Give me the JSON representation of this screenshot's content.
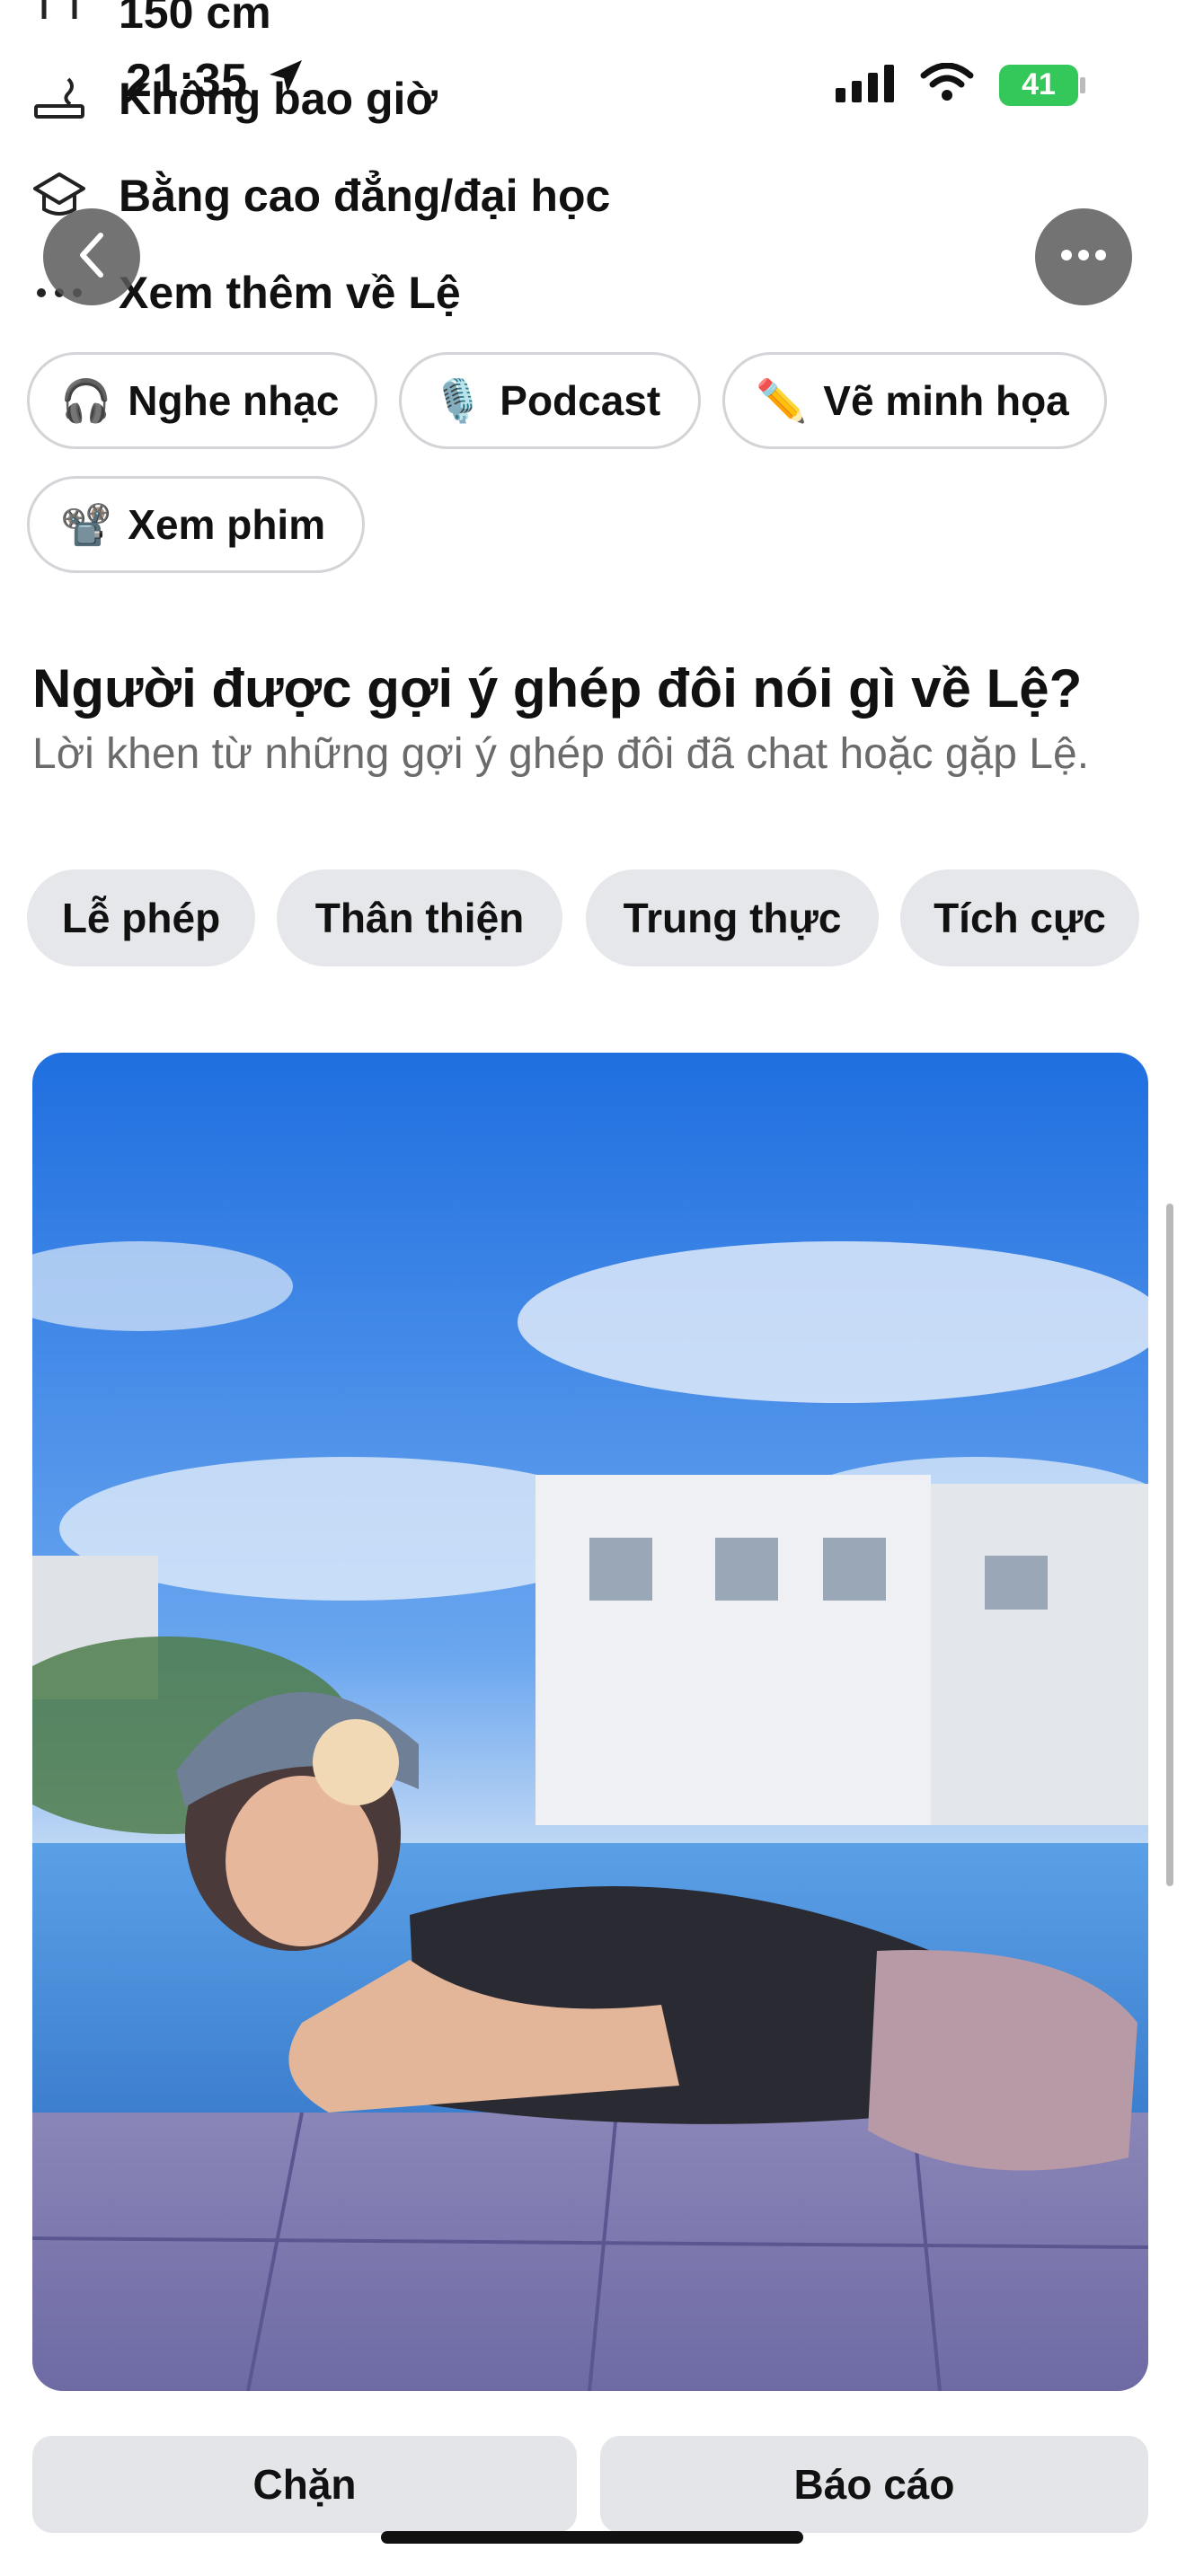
{
  "status_bar": {
    "time": "21:35",
    "battery": "41"
  },
  "info": {
    "height": "150 cm",
    "smoking": "Không bao giờ",
    "education": "Bằng cao đẳng/đại học",
    "more": "Xem thêm về Lệ"
  },
  "interests": [
    {
      "label": "Nghe nhạc",
      "emoji": "🎧"
    },
    {
      "label": "Podcast",
      "emoji": "🎙️"
    },
    {
      "label": "Vẽ minh họa",
      "emoji": "✏️"
    },
    {
      "label": "Xem phim",
      "emoji": "📽️"
    }
  ],
  "compliments": {
    "title": "Người được gợi ý ghép đôi nói gì về Lệ?",
    "subtitle": "Lời khen từ những gợi ý ghép đôi đã chat hoặc gặp Lệ.",
    "tags": [
      "Lễ phép",
      "Thân thiện",
      "Trung thực",
      "Tích cực"
    ]
  },
  "actions": {
    "block": "Chặn",
    "report": "Báo cáo"
  },
  "colors": {
    "battery": "#34c759",
    "chip_border": "#d4d4d8",
    "tag_bg": "#e6e7ea",
    "button_bg": "#e4e5e8"
  }
}
